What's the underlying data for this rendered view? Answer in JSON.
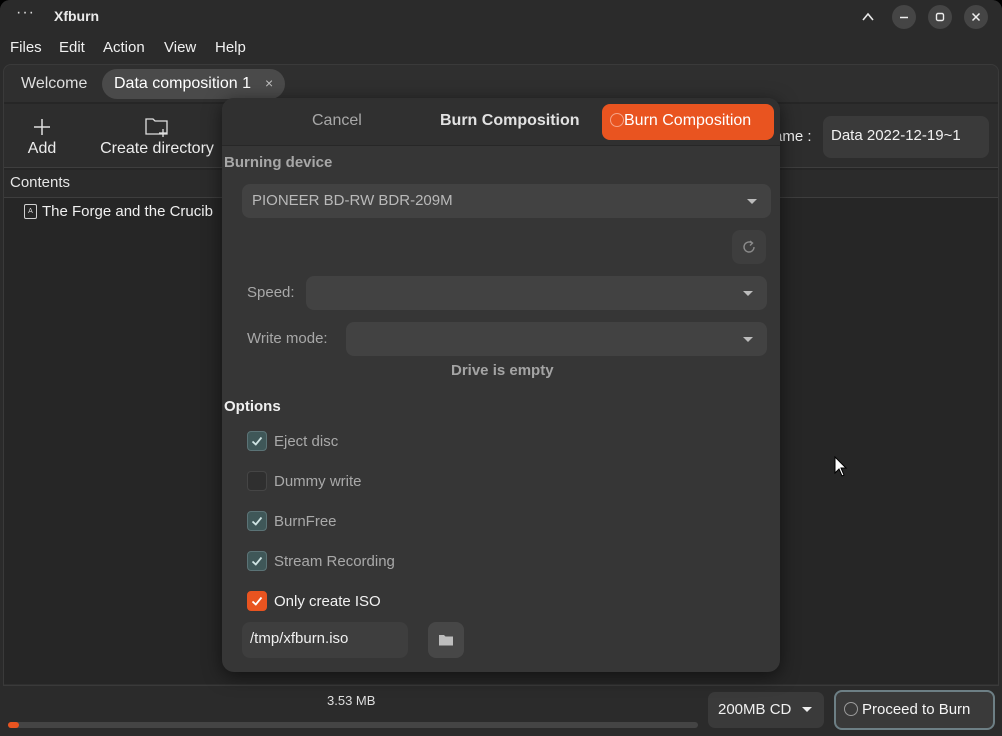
{
  "window": {
    "title": "Xfburn",
    "menu_dots": "···"
  },
  "menubar": {
    "items": [
      "Files",
      "Edit",
      "Action",
      "View",
      "Help"
    ]
  },
  "tabs": [
    {
      "label": "Welcome"
    },
    {
      "label": "Data composition 1",
      "close": "×"
    }
  ],
  "toolbar": {
    "add_label": "Add",
    "create_dir_label": "Create directory",
    "name_label": "ame :",
    "name_value": "Data 2022-12-19~1"
  },
  "contents": {
    "header": "Contents",
    "items": [
      "The Forge and the Crucib"
    ]
  },
  "dialog": {
    "cancel_label": "Cancel",
    "title": "Burn Composition",
    "burn_label": "Burn Composition",
    "burning_device_heading": "Burning device",
    "device_value": "PIONEER BD-RW BDR-209M",
    "speed_label": "Speed:",
    "write_mode_label": "Write mode:",
    "drive_status": "Drive is empty",
    "options_heading": "Options",
    "options": [
      {
        "label": "Eject disc",
        "checked": true
      },
      {
        "label": "Dummy write",
        "checked": false
      },
      {
        "label": "BurnFree",
        "checked": true
      },
      {
        "label": "Stream Recording",
        "checked": true
      },
      {
        "label": "Only create ISO",
        "checked": true
      }
    ],
    "iso_path": "/tmp/xfburn.iso"
  },
  "statusbar": {
    "size": "3.53 MB",
    "progress": 0.016,
    "disc_type": "200MB CD",
    "proceed_label": "Proceed to Burn"
  },
  "colors": {
    "accent": "#e95420",
    "checkbox": "#3f5758"
  },
  "icons": [
    "plus-icon",
    "folder-new-icon",
    "document-icon",
    "refresh-icon",
    "folder-icon",
    "disc-icon",
    "minimize-icon",
    "maximize-icon",
    "close-icon",
    "caret-up-icon"
  ]
}
